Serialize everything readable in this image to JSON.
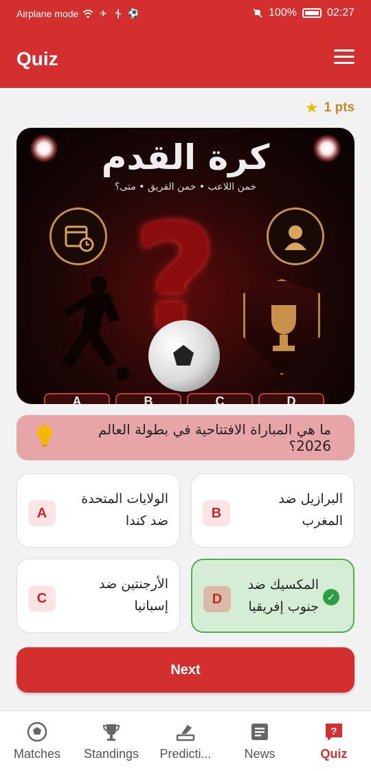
{
  "status_bar": {
    "left_text": "Airplane mode",
    "battery_percent": "100%",
    "time": "02:27"
  },
  "app_bar": {
    "title": "Quiz",
    "menu_icon": "hamburger-menu-icon"
  },
  "points": {
    "value": "1 pts",
    "icon": "star-icon"
  },
  "banner": {
    "title": "كرة القدم",
    "subtitle": "خمن اللاعب • خمن الفريق • متى؟",
    "tab_letters": [
      "A",
      "B",
      "C",
      "D"
    ]
  },
  "question": {
    "text": "ما هي المباراة الافتتاحية في بطولة العالم 2026؟",
    "icon": "lightbulb-icon"
  },
  "answers": [
    {
      "letter": "A",
      "text": "الولايات المتحدة ضد كندا",
      "state": "default"
    },
    {
      "letter": "B",
      "text": "البرازيل ضد المغرب",
      "state": "default"
    },
    {
      "letter": "C",
      "text": "الأرجنتين ضد إسبانيا",
      "state": "default"
    },
    {
      "letter": "D",
      "text": "المكسيك ضد جنوب إفريقيا",
      "state": "correct"
    }
  ],
  "next_button": {
    "label": "Next"
  },
  "bottom_nav": [
    {
      "label": "Matches",
      "icon": "soccer-ball-icon",
      "active": false
    },
    {
      "label": "Standings",
      "icon": "trophy-icon",
      "active": false
    },
    {
      "label": "Predicti...",
      "icon": "prediction-icon",
      "active": false
    },
    {
      "label": "News",
      "icon": "news-icon",
      "active": false
    },
    {
      "label": "Quiz",
      "icon": "quiz-icon",
      "active": true
    }
  ],
  "colors": {
    "primary": "#d32f2f",
    "correct_border": "#4caf50",
    "correct_bg": "#d5edd5",
    "points_text": "#c0872a"
  }
}
